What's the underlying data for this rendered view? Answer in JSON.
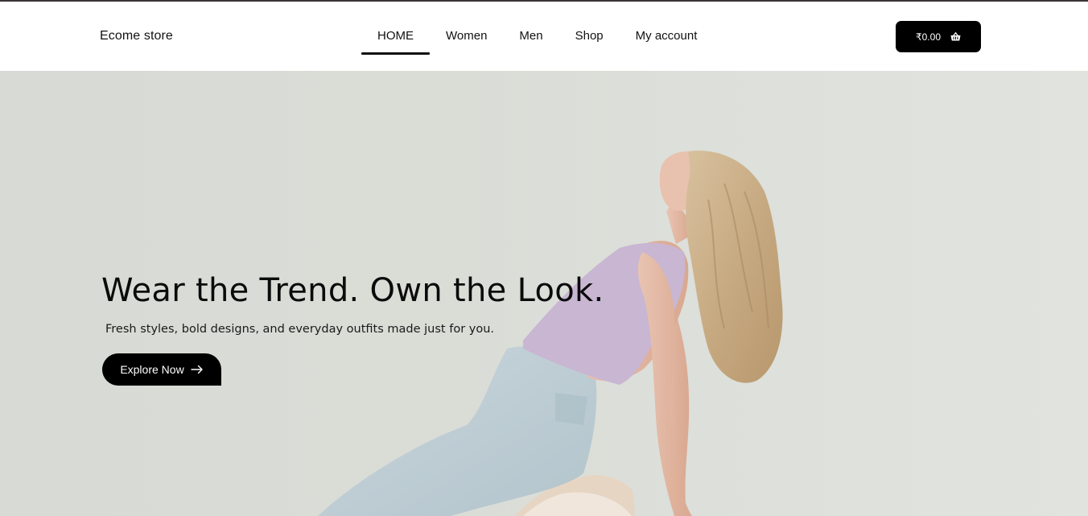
{
  "header": {
    "logo": "Ecome store",
    "nav": [
      {
        "label": "HOME",
        "active": true
      },
      {
        "label": "Women",
        "active": false
      },
      {
        "label": "Men",
        "active": false
      },
      {
        "label": "Shop",
        "active": false
      },
      {
        "label": "My account",
        "active": false
      }
    ],
    "cart": {
      "total": "₹0.00",
      "icon": "basket-icon"
    }
  },
  "hero": {
    "title": "Wear the Trend. Own the Look.",
    "subtitle": "Fresh styles, bold designs, and everyday outfits made just for you.",
    "cta_label": "Explore Now",
    "cta_icon": "arrow-right-icon"
  },
  "colors": {
    "header_bg": "#ffffff",
    "hero_bg": "#d9dcd6",
    "button_bg": "#000000",
    "text": "#111111"
  }
}
